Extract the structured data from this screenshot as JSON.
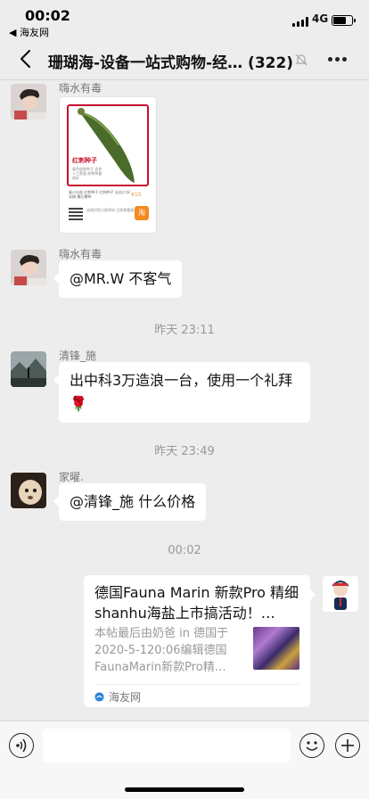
{
  "status_bar": {
    "time": "00:02",
    "back_app": "◀ 海友网",
    "network": "4G",
    "battery_level": 0.7
  },
  "nav": {
    "title": "珊瑚海-设备一站式购物-经…",
    "member_count": "(322)"
  },
  "messages": {
    "m1": {
      "sender": "嗨水有毒"
    },
    "sticker": {
      "title": "红刺种子",
      "subtitle": "青色皮肤种子 适合人工养殖 耐寒种量很好",
      "desc": "青小瓜苗 红刺种子 红刺种子 长瓜口 好采摘 播后播种",
      "price": "¥15",
      "qr_info": "长按识别小程序码 立即查看商品详情",
      "logo": "淘"
    },
    "m2": {
      "sender": "嗨水有毒",
      "text": "@MR.W 不客气"
    },
    "ts1": "昨天 23:11",
    "m3": {
      "sender": "清锋_施",
      "text": "出中科3万造浪一台，使用一个礼拜🌹"
    },
    "ts2": "昨天 23:49",
    "m4": {
      "sender": "家曜.",
      "text": "@清锋_施 什么价格"
    },
    "ts3": "00:02",
    "link": {
      "title": "德国Fauna Marin 新款Pro 精细shanhu海盐上市搞活动！…",
      "desc": "本帖最后由奶爸 in 德国于2020-5-120:06编辑德国FaunaMarin新款Pro精…",
      "source": "海友网"
    }
  },
  "colors": {
    "background": "#ededed",
    "bubble": "#ffffff",
    "sticker_accent": "#c8102e",
    "timestamp": "#999999"
  }
}
